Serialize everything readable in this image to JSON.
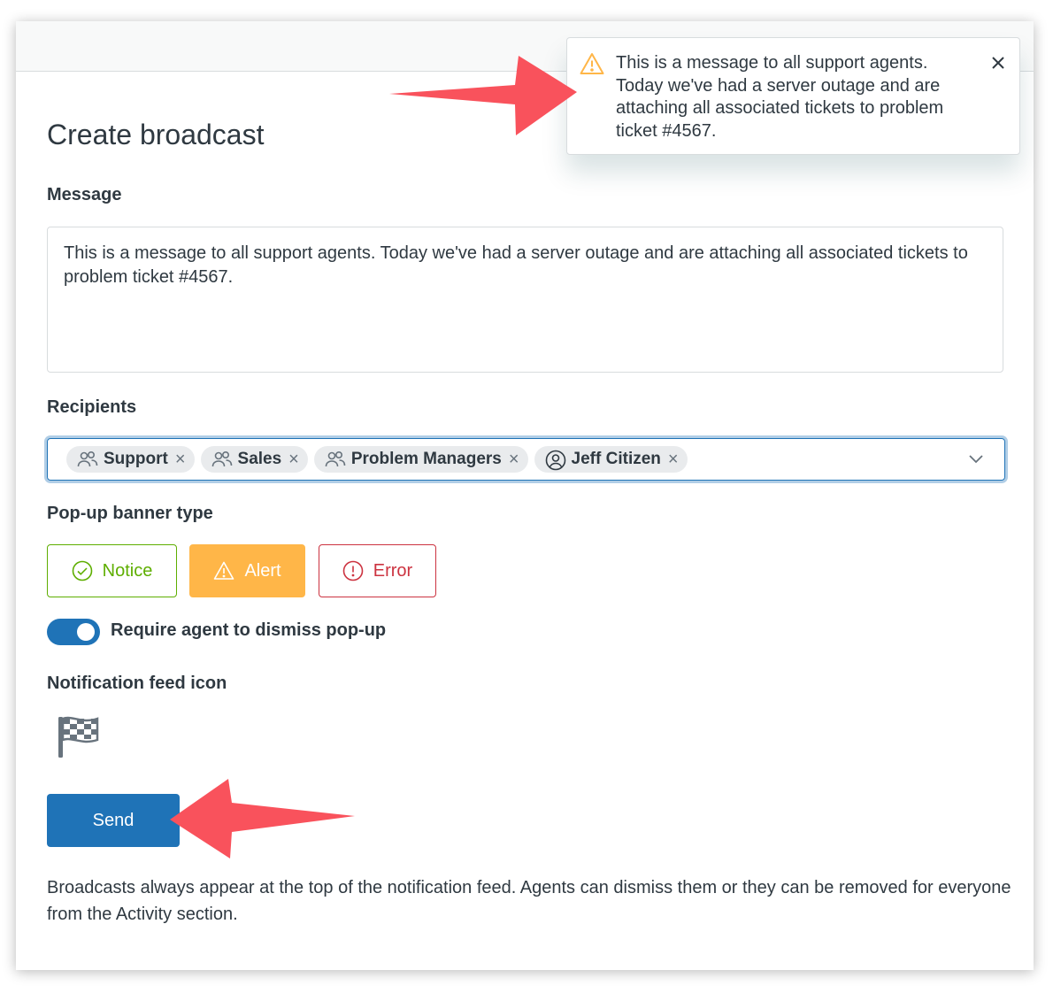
{
  "page": {
    "heading": "Create broadcast"
  },
  "message": {
    "label": "Message",
    "value": "This is a message to all support agents. Today we've had a server outage and are attaching all associated tickets to problem ticket #4567."
  },
  "recipients": {
    "label": "Recipients",
    "tags": [
      {
        "label": "Support",
        "icon": "group-icon"
      },
      {
        "label": "Sales",
        "icon": "group-icon"
      },
      {
        "label": "Problem Managers",
        "icon": "group-icon"
      },
      {
        "label": "Jeff Citizen",
        "icon": "user-icon"
      }
    ]
  },
  "banner_type": {
    "label": "Pop-up banner type",
    "options": [
      {
        "label": "Notice",
        "icon": "check-circle-icon",
        "color": "#5eae00"
      },
      {
        "label": "Alert",
        "icon": "warning-icon",
        "color": "#ffb648",
        "selected": true
      },
      {
        "label": "Error",
        "icon": "error-circle-icon",
        "color": "#cc3340"
      }
    ]
  },
  "dismiss_toggle": {
    "label": "Require agent to dismiss pop-up",
    "on": true
  },
  "feed_icon": {
    "label": "Notification feed icon",
    "icon": "checkered-flag-icon"
  },
  "send_button": {
    "label": "Send"
  },
  "footnote": "Broadcasts always appear at the top of the notification feed. Agents can dismiss them or they can be removed for everyone from the Activity section.",
  "toast": {
    "icon": "warning-icon",
    "message": "This is a message to all support agents. Today we've had a server outage and are attaching all associated tickets to problem ticket #4567."
  },
  "colors": {
    "primary": "#1f73b7",
    "alert": "#ffb648",
    "annotation_arrow": "#f9525c"
  }
}
